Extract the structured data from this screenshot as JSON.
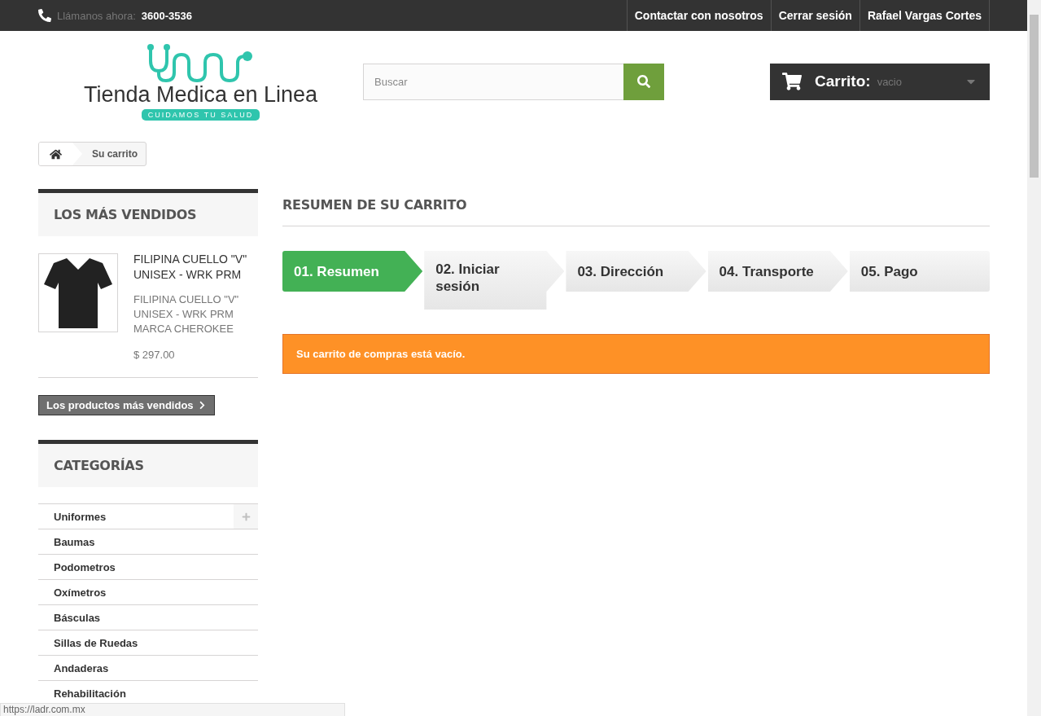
{
  "topbar": {
    "phone_label": "Llámanos ahora:",
    "phone": "3600-3536",
    "links": [
      "Contactar con nosotros",
      "Cerrar sesión",
      "Rafael Vargas Cortes"
    ]
  },
  "logo": {
    "name": "Tienda Medica en Linea",
    "tagline": "CUIDAMOS TU SALUD"
  },
  "search": {
    "placeholder": "Buscar"
  },
  "cart": {
    "label": "Carrito:",
    "status": "vacio"
  },
  "breadcrumb": {
    "current": "Su carrito"
  },
  "bestsellers": {
    "title": "LOS MÁS VENDIDOS",
    "products": [
      {
        "name": "FILIPINA CUELLO \"V\" UNISEX - WRK PRM",
        "description": "FILIPINA CUELLO \"V\" UNISEX - WRK PRM MARCA CHEROKEE",
        "price": "$ 297.00"
      }
    ],
    "button": "Los productos más vendidos"
  },
  "categories": {
    "title": "CATEGORÍAS",
    "items": [
      {
        "label": "Uniformes",
        "expandable": true
      },
      {
        "label": "Baumas",
        "expandable": false
      },
      {
        "label": "Podometros",
        "expandable": false
      },
      {
        "label": "Oxímetros",
        "expandable": false
      },
      {
        "label": "Básculas",
        "expandable": false
      },
      {
        "label": "Sillas de Ruedas",
        "expandable": false
      },
      {
        "label": "Andaderas",
        "expandable": false
      },
      {
        "label": "Rehabilitación",
        "expandable": false
      }
    ]
  },
  "main": {
    "title": "RESUMEN DE SU CARRITO",
    "steps": [
      {
        "label": "01. Resumen",
        "selected": true
      },
      {
        "label": "02. Iniciar sesión",
        "selected": false
      },
      {
        "label": "03. Dirección",
        "selected": false
      },
      {
        "label": "04. Transporte",
        "selected": false
      },
      {
        "label": "05. Pago",
        "selected": false
      }
    ],
    "alert": "Su carrito de compras está vacío."
  },
  "status_bar": {
    "url": "https://ladr.com.mx"
  }
}
